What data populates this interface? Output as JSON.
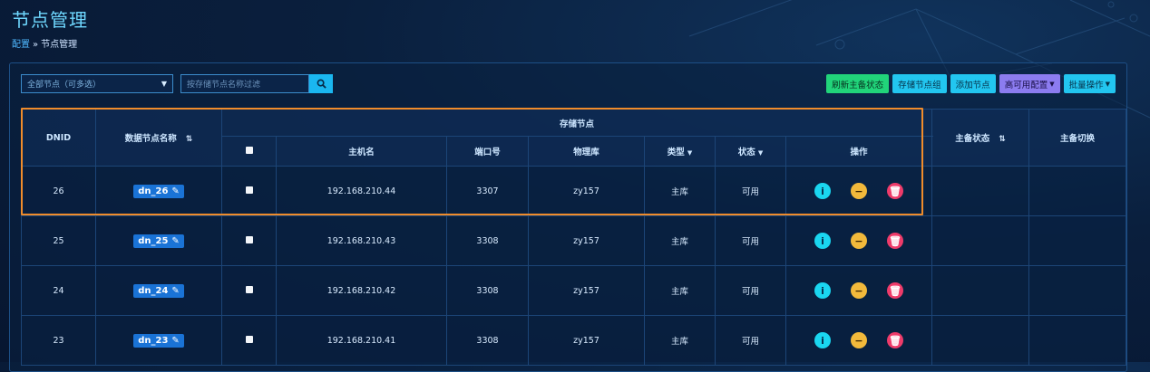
{
  "page": {
    "title": "节点管理"
  },
  "breadcrumb": {
    "root": "配置",
    "separator": "»",
    "current": "节点管理"
  },
  "toolbar": {
    "node_select": "全部节点（可多选）",
    "filter_placeholder": "按存储节点名称过滤",
    "buttons": {
      "refresh_master": "刷新主备状态",
      "storage_group": "存储节点组",
      "add_node": "添加节点",
      "ha_config": "高可用配置",
      "batch_ops": "批量操作"
    }
  },
  "table": {
    "headers": {
      "dnid": "DNID",
      "data_node_name": "数据节点名称",
      "storage_node": "存储节点",
      "hostname": "主机名",
      "port": "端口号",
      "physical_db": "物理库",
      "type": "类型",
      "status": "状态",
      "actions": "操作",
      "master_status": "主备状态",
      "master_switch": "主备切换"
    },
    "rows": [
      {
        "dnid": "26",
        "name": "dn_26",
        "host": "192.168.210.44",
        "port": "3307",
        "db": "zy157",
        "type": "主库",
        "status": "可用"
      },
      {
        "dnid": "25",
        "name": "dn_25",
        "host": "192.168.210.43",
        "port": "3308",
        "db": "zy157",
        "type": "主库",
        "status": "可用"
      },
      {
        "dnid": "24",
        "name": "dn_24",
        "host": "192.168.210.42",
        "port": "3308",
        "db": "zy157",
        "type": "主库",
        "status": "可用"
      },
      {
        "dnid": "23",
        "name": "dn_23",
        "host": "192.168.210.41",
        "port": "3308",
        "db": "zy157",
        "type": "主库",
        "status": "可用"
      }
    ]
  },
  "colors": {
    "accent": "#22c6f0",
    "highlight": "#f08c2b",
    "ok": "#2ee078"
  }
}
